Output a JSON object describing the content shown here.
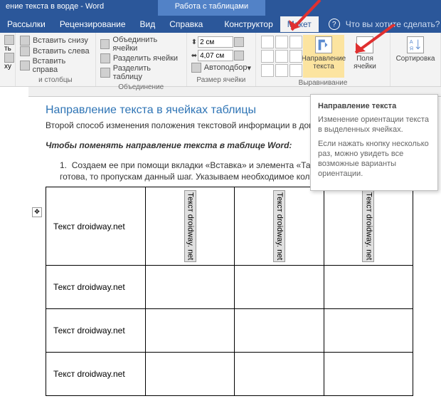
{
  "title": {
    "doc": "ение текста в ворде  -  Word",
    "contextual": "Работа с таблицами"
  },
  "tabs": {
    "t1": "Рассылки",
    "t2": "Рецензирование",
    "t3": "Вид",
    "t4": "Справка",
    "t5": "Конструктор",
    "t6": "Макет",
    "tellme": "Что вы хотите сделать?"
  },
  "ribbon": {
    "insertBelow": "Вставить снизу",
    "insertLeft": "Вставить слева",
    "insertRight": "Вставить справа",
    "g1": "и столбцы",
    "mergeCells": "Объединить ячейки",
    "splitCells": "Разделить ячейки",
    "splitTable": "Разделить таблицу",
    "g2": "Объединение",
    "height": "2 см",
    "width": "4,07 см",
    "autofit": "Автоподбор",
    "g3": "Размер ячейки",
    "textDir": "Направление текста",
    "margins": "Поля ячейки",
    "g4": "Выравнивание",
    "sort": "Сортировка"
  },
  "tooltip": {
    "title": "Направление текста",
    "p1": "Изменение ориентации текста в выделенных ячейках.",
    "p2": "Если нажать кнопку несколько раз, можно увидеть все возможные варианты ориентации."
  },
  "doc": {
    "heading": "Направление текста в ячейках таблицы",
    "intro": "Второй способ изменения положения текстовой информации в документаблицу.",
    "boldline": "Чтобы поменять направление текста в таблице Word:",
    "listnum": "1.",
    "listitem": "Создаем ее при помощи вкладки «Вставка» и элемента «Таблица», если таблица у вас готова, то пропускам данный шаг. Указываем необходимое количество ячеек.",
    "cellH": "Текст droidway.net",
    "cellV": "Текст droidway. net"
  },
  "misc": {
    "anchor": "✥",
    "help": "?"
  }
}
